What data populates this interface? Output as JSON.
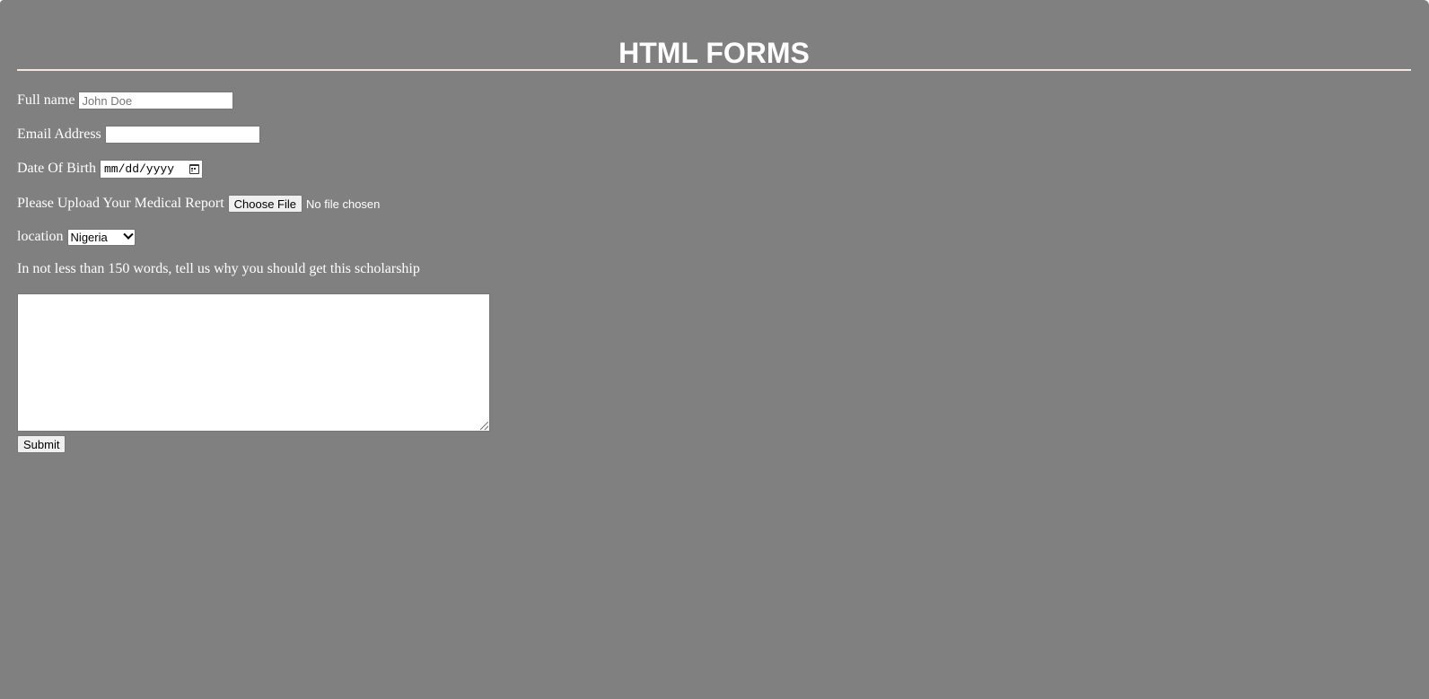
{
  "header": {
    "title": "HTML FORMS"
  },
  "form": {
    "full_name": {
      "label": "Full name",
      "placeholder": "John Doe",
      "value": ""
    },
    "email": {
      "label": "Email Address",
      "value": ""
    },
    "dob": {
      "label": "Date Of Birth",
      "placeholder": "mm/dd/yyyy",
      "icon": "calendar-icon"
    },
    "upload": {
      "label": "Please Upload Your Medical Report",
      "button_label": "Choose File",
      "status": "No file chosen"
    },
    "location": {
      "label": "location",
      "selected": "Nigeria",
      "icon": "chevron-down-icon"
    },
    "essay": {
      "label": "In not less than 150 words, tell us why you should get this scholarship",
      "value": ""
    },
    "submit_label": "Submit"
  },
  "colors": {
    "page_background": "#808080",
    "text": "#ffffff",
    "rule": "#f3e6de"
  }
}
